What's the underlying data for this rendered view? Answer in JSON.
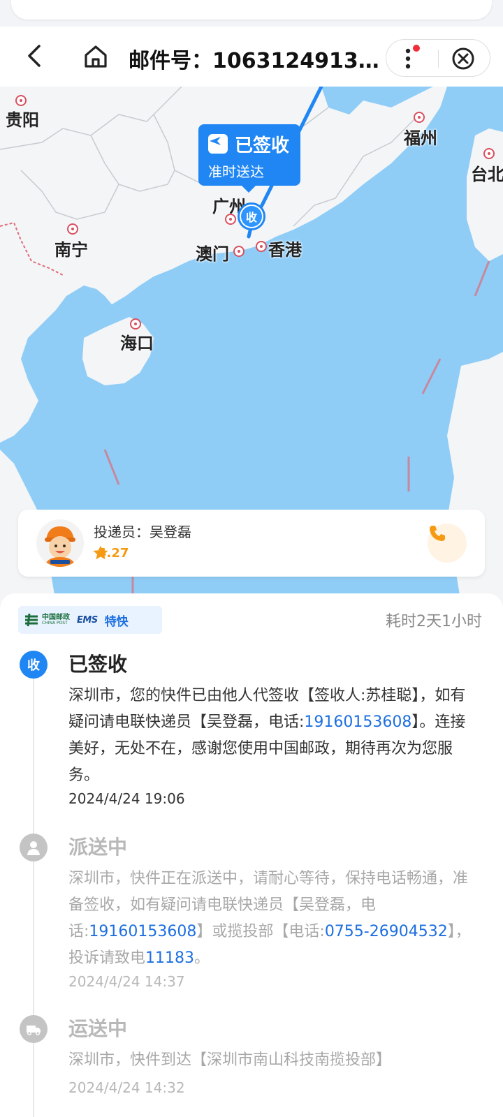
{
  "header": {
    "title": "邮件号：1063124913..."
  },
  "map": {
    "cities": [
      {
        "name": "贵阳"
      },
      {
        "name": "福州"
      },
      {
        "name": "台北"
      },
      {
        "name": "广州"
      },
      {
        "name": "南宁"
      },
      {
        "name": "澳门"
      },
      {
        "name": "香港"
      },
      {
        "name": "海口"
      }
    ],
    "bubble": {
      "status": "已签收",
      "sub": "准时送达"
    },
    "receive_marker": "收"
  },
  "courier": {
    "label": "投递员：吴登磊",
    "rating": "4.27",
    "stars": 4.27
  },
  "detail": {
    "brand_cn": "中国邮政",
    "brand_en": "CHINA POST",
    "ems": "EMS",
    "service": "特快",
    "elapsed": "耗时2天1小时",
    "events": [
      {
        "icon_text": "收",
        "status": "已签收",
        "desc_before": "深圳市，您的快件已由他人代签收【签收人:苏桂聪】，如有疑问请电联快递员【吴登磊，电话:",
        "phone": "19160153608",
        "desc_after": "】。连接美好，无处不在，感谢您使用中国邮政，期待再次为您服务。",
        "time": "2024/4/24 19:06"
      },
      {
        "status": "派送中",
        "desc_before": "深圳市，快件正在派送中，请耐心等待，保持电话畅通，准备签收，如有疑问请电联快递员【吴登磊，电话:",
        "phone": "19160153608",
        "desc_mid": "】或揽投部【电话:",
        "phone2": "0755-26904532",
        "desc_mid2": "】，投诉请致电",
        "phone3": "11183",
        "desc_after": "。",
        "time": "2024/4/24 14:37"
      },
      {
        "status": "运送中",
        "desc_before": "深圳市，快件到达【深圳市南山科技南揽投部】",
        "time": "2024/4/24 14:32"
      }
    ]
  },
  "colors": {
    "accent": "#1f86f3",
    "link": "#1d6fe0",
    "star": "#f59a12",
    "gray": "#b8b8b8"
  }
}
